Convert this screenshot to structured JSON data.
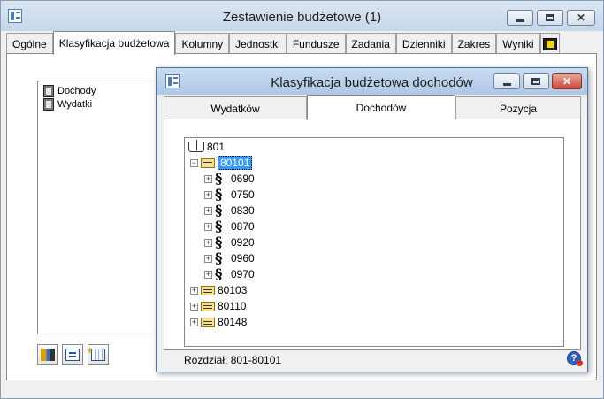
{
  "outer_window": {
    "title": "Zestawienie budżetowe (1)",
    "tabs": [
      "Ogólne",
      "Klasyfikacja budżetowa",
      "Kolumny",
      "Jednostki",
      "Fundusze",
      "Zadania",
      "Dzienniki",
      "Zakres",
      "Wyniki"
    ],
    "active_tab": "Klasyfikacja budżetowa",
    "list_items": [
      "Dochody",
      "Wydatki"
    ]
  },
  "inner_window": {
    "title": "Klasyfikacja budżetowa dochodów",
    "tabs": [
      "Wydatków",
      "Dochodów",
      "Pozycja"
    ],
    "active_tab": "Dochodów",
    "tree": {
      "root": "801",
      "selected": "80101",
      "children_of_selected": [
        "0690",
        "0750",
        "0830",
        "0870",
        "0920",
        "0960",
        "0970"
      ],
      "siblings": [
        "80103",
        "80110",
        "80148"
      ]
    },
    "status": "Rozdział: 801-80101"
  },
  "colors": {
    "outer_titlebar": "#c6d6ea",
    "inner_titlebar": "#aec8e6",
    "selection": "#3399ff"
  }
}
